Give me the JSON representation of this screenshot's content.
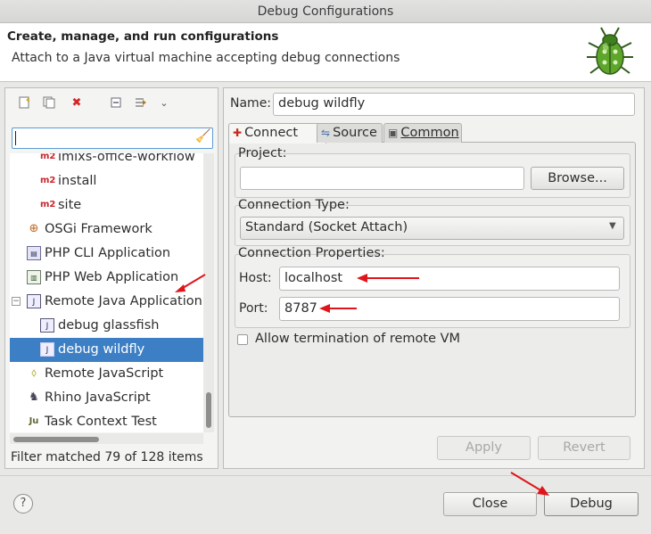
{
  "window": {
    "title": "Debug Configurations"
  },
  "banner": {
    "title": "Create, manage, and run configurations",
    "description": "Attach to a Java virtual machine accepting debug connections"
  },
  "toolbar": {
    "buttons": [
      "new-configuration-icon",
      "duplicate-icon",
      "delete-icon",
      "collapse-all-icon",
      "filter-icon",
      "dropdown-icon"
    ]
  },
  "filter": {
    "value": "",
    "status": "Filter matched 79 of 128 items"
  },
  "tree": [
    {
      "label": "imixs-office-workflow",
      "icon": "m2"
    },
    {
      "label": "install",
      "icon": "m2"
    },
    {
      "label": "site",
      "icon": "m2"
    },
    {
      "label": "OSGi Framework",
      "icon": "osgi"
    },
    {
      "label": "PHP CLI Application",
      "icon": "php"
    },
    {
      "label": "PHP Web Application",
      "icon": "php"
    },
    {
      "label": "Remote Java Application",
      "icon": "remote",
      "expander": "−"
    },
    {
      "label": "debug glassfish",
      "icon": "remote"
    },
    {
      "label": "debug wildfly",
      "icon": "remote",
      "selected": true
    },
    {
      "label": "Remote JavaScript",
      "icon": "js"
    },
    {
      "label": "Rhino JavaScript",
      "icon": "rhino"
    },
    {
      "label": "Task Context Test",
      "icon": "ju"
    }
  ],
  "config": {
    "name_label": "Name:",
    "name_value": "debug wildfly",
    "tabs": [
      {
        "label": "Connect",
        "active": true
      },
      {
        "label": "Source"
      },
      {
        "label": "Common"
      }
    ],
    "project_label": "Project:",
    "project_value": "",
    "browse_label": "Browse...",
    "connection_type_label": "Connection Type:",
    "connection_type_value": "Standard (Socket Attach)",
    "connection_props_label": "Connection Properties:",
    "host_label": "Host:",
    "host_value": "localhost",
    "port_label": "Port:",
    "port_value": "8787",
    "allow_termination_label": "Allow termination of remote VM",
    "allow_termination_checked": false,
    "apply_label": "Apply",
    "revert_label": "Revert"
  },
  "footer": {
    "help": "?",
    "close_label": "Close",
    "debug_label": "Debug"
  },
  "colors": {
    "selection": "#3d7fc4",
    "annotation_arrow": "#e0151b",
    "filter_border": "#5b9bd5"
  }
}
